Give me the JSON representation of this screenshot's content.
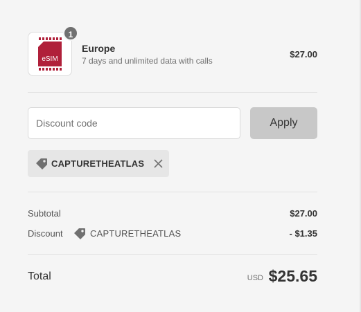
{
  "product": {
    "name": "Europe",
    "description": "7 days and unlimited data with calls",
    "price": "$27.00",
    "quantity": "1",
    "thumbnail_icon": "esim-card-icon",
    "thumbnail_text": "eSIM",
    "accent_color": "#b0203a"
  },
  "discount": {
    "placeholder": "Discount code",
    "value": "",
    "apply_label": "Apply",
    "applied_code": "CAPTURETHEATLAS",
    "tag_icon": "tag-icon",
    "remove_icon": "close-icon"
  },
  "summary": {
    "subtotal_label": "Subtotal",
    "subtotal_value": "$27.00",
    "discount_label": "Discount",
    "discount_code": "CAPTURETHEATLAS",
    "discount_value": "- $1.35",
    "total_label": "Total",
    "currency": "USD",
    "total_value": "$25.65"
  }
}
